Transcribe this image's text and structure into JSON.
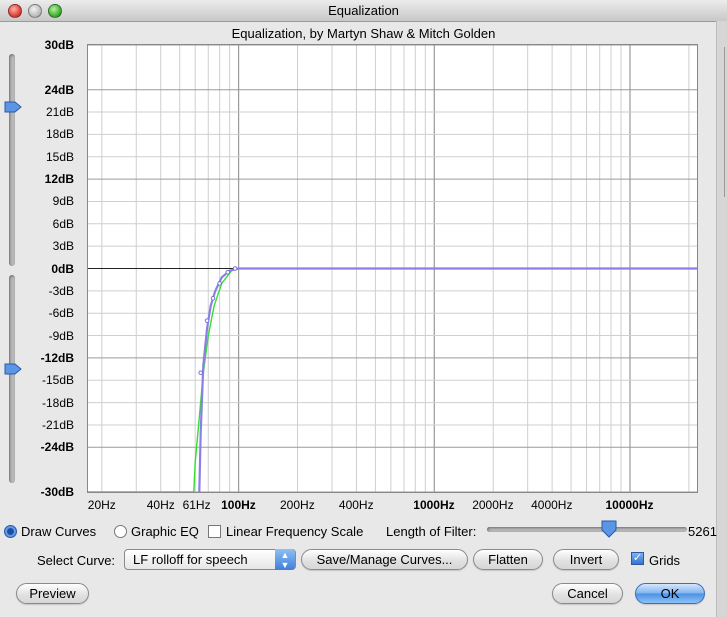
{
  "window": {
    "title": "Equalization"
  },
  "subtitle": "Equalization, by Martyn Shaw & Mitch Golden",
  "chart_data": {
    "type": "line",
    "x_scale": "log",
    "xlim": [
      17,
      22000
    ],
    "ylim": [
      -30,
      30
    ],
    "yticks": [
      {
        "v": 30,
        "label": "30dB",
        "bold": true
      },
      {
        "v": 24,
        "label": "24dB",
        "bold": true
      },
      {
        "v": 21,
        "label": "21dB"
      },
      {
        "v": 18,
        "label": "18dB"
      },
      {
        "v": 15,
        "label": "15dB"
      },
      {
        "v": 12,
        "label": "12dB",
        "bold": true
      },
      {
        "v": 9,
        "label": "9dB"
      },
      {
        "v": 6,
        "label": "6dB"
      },
      {
        "v": 3,
        "label": "3dB"
      },
      {
        "v": 0,
        "label": "0dB",
        "bold": true
      },
      {
        "v": -3,
        "label": "-3dB"
      },
      {
        "v": -6,
        "label": "-6dB"
      },
      {
        "v": -9,
        "label": "-9dB"
      },
      {
        "v": -12,
        "label": "-12dB",
        "bold": true
      },
      {
        "v": -15,
        "label": "-15dB"
      },
      {
        "v": -18,
        "label": "-18dB"
      },
      {
        "v": -21,
        "label": "-21dB"
      },
      {
        "v": -24,
        "label": "-24dB",
        "bold": true
      },
      {
        "v": -30,
        "label": "-30dB",
        "bold": true
      }
    ],
    "xticks": [
      {
        "v": 20,
        "label": "20Hz"
      },
      {
        "v": 40,
        "label": "40Hz"
      },
      {
        "v": 61,
        "label": "61Hz"
      },
      {
        "v": 100,
        "label": "100Hz",
        "bold": true
      },
      {
        "v": 200,
        "label": "200Hz"
      },
      {
        "v": 400,
        "label": "400Hz"
      },
      {
        "v": 1000,
        "label": "1000Hz",
        "bold": true
      },
      {
        "v": 2000,
        "label": "2000Hz"
      },
      {
        "v": 4000,
        "label": "4000Hz"
      },
      {
        "v": 10000,
        "label": "10000Hz",
        "bold": true
      }
    ],
    "grid": true,
    "series": [
      {
        "color": "#33dd33",
        "points": [
          [
            17,
            -30
          ],
          [
            59,
            -30
          ],
          [
            60,
            -26
          ],
          [
            63,
            -20
          ],
          [
            66,
            -14
          ],
          [
            70,
            -9
          ],
          [
            75,
            -5
          ],
          [
            82,
            -2
          ],
          [
            92,
            -0.3
          ],
          [
            100,
            0
          ],
          [
            22000,
            0
          ]
        ]
      },
      {
        "color": "#8a7fe6",
        "points": [
          [
            63,
            -30
          ],
          [
            64,
            -22
          ],
          [
            66,
            -13
          ],
          [
            69,
            -8
          ],
          [
            72,
            -5
          ],
          [
            76,
            -3
          ],
          [
            82,
            -1.2
          ],
          [
            90,
            -0.3
          ],
          [
            100,
            0
          ],
          [
            22000,
            0
          ]
        ]
      }
    ],
    "control_points": [
      [
        64,
        -14
      ],
      [
        69,
        -7
      ],
      [
        74,
        -4
      ],
      [
        80,
        -2
      ],
      [
        88,
        -0.5
      ],
      [
        96,
        0
      ]
    ]
  },
  "controls": {
    "draw_curves": "Draw Curves",
    "graphic_eq": "Graphic EQ",
    "linear_freq": "Linear Frequency Scale",
    "length_label": "Length of Filter:",
    "length_value": "5261",
    "length_fraction": 0.61,
    "select_curve_label": "Select Curve:",
    "curve_selected": "LF rolloff for speech",
    "save_manage": "Save/Manage Curves...",
    "flatten": "Flatten",
    "invert": "Invert",
    "grids": "Grids",
    "preview": "Preview",
    "cancel": "Cancel",
    "ok": "OK"
  },
  "sliders": {
    "max_db_fraction": 0.25,
    "min_db_fraction": 0.45
  },
  "colors": {
    "accent": "#3f7fd8",
    "curve_green": "#33dd33",
    "curve_purple": "#8a7fe6"
  }
}
